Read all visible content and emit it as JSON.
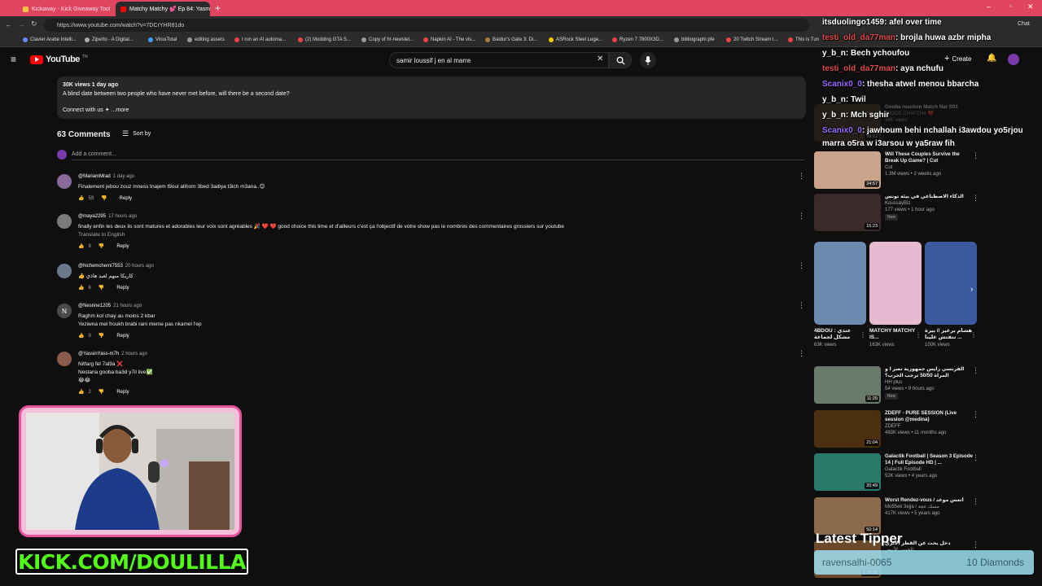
{
  "browser": {
    "tabs": [
      {
        "title": "Kickaway - Kick Giveaway Tool",
        "active": false
      },
      {
        "title": "Matchy Matchy 💕 Ep 84: Yasmin...",
        "active": true
      }
    ],
    "url": "https://www.youtube.com/watch?v=7DCrYHR81do",
    "bookmarks": [
      "Clavier Arabe Intelli...",
      "Ziperto - A Digital...",
      "VirusTotal",
      "editing assets",
      "I run an AI automa...",
      "(2) Modding GTA S...",
      "Copy of hr-newslet...",
      "Napkin AI - The vis...",
      "Baidur's Gate 3: Di...",
      "ASRock Steel Lege...",
      "Ryzen 7 7800X3D...",
      "bibliographi pfe",
      "20 Twitch Stream I...",
      "This is Tun"
    ],
    "chat_label": "Chat"
  },
  "youtube": {
    "logo": "YouTube",
    "logo_sup": "TN",
    "search_value": "samir loussif j en al marre",
    "create_label": "Create"
  },
  "description": {
    "meta": "30K views  1 day ago",
    "text": "A blind date between two people who have never met before, will there be a second date?",
    "connect": "Connect with us  ✦  ...more"
  },
  "comments_header": {
    "count": "63 Comments",
    "sort": "Sort by",
    "add_placeholder": "Add a comment..."
  },
  "comments": [
    {
      "author": "@MariamMrad",
      "time": "1 day ago",
      "lines": [
        "Finalement jebou zouz mness tnajem t9oul alihom 3bed 3adiya t3ich m3ana..😊"
      ],
      "likes": "59",
      "extra": "",
      "avatar_color": "#8a6a9a"
    },
    {
      "author": "@maya2295",
      "time": "17 hours ago",
      "lines": [
        "finally enfin les deux ils sont matures et adorables leur voix sont agréables 🎉 ❤️ ❤️ good choice this time et d'ailleurs c'est ça l'objectif de votre show pas le nombres des commentaires grossiers sur youtube"
      ],
      "likes": "8",
      "extra": "Translate to English",
      "avatar_color": "#7a7a7a"
    },
    {
      "author": "@hichemchemi7553",
      "time": "20 hours ago",
      "lines": [
        "👍 كاريكا منهم لعبد هاذي"
      ],
      "likes": "6",
      "extra": "",
      "avatar_color": "#6a7a8a"
    },
    {
      "author": "@Nesrine1205",
      "time": "21 hours ago",
      "lines": [
        "Raghm kol chay au moins 2 kbar",
        "Yeziwna mel froukh brabi rani meme pas nkamel l'ep"
      ],
      "likes": "9",
      "extra": "",
      "avatar_color": "#4a4a4a",
      "initial": "N"
    },
    {
      "author": "@YassinYass-m7h",
      "time": "2 hours ago",
      "lines": [
        "Nitfarg fel 7al9a ❌",
        "Nestana gooba ba3d y7il live✅",
        "😂😂"
      ],
      "likes": "2",
      "extra": "",
      "avatar_color": "#8a5a4a"
    }
  ],
  "reply_label": "Reply",
  "related": [
    {
      "title": "Will These Couples Survive the Break Up Game? | Cut",
      "channel": "Cut",
      "meta": "1.3M views • 2 weeks ago",
      "duration": "24:57",
      "new": false,
      "color": "#c9a38a"
    },
    {
      "title": "الذكاء الاصطناعي في بيئة تونس",
      "channel": "KoussayBiz",
      "meta": "177 views • 1 hour ago",
      "duration": "15:23",
      "new": true,
      "color": "#3a2a2a"
    },
    {
      "title": "الفرنسي رايس جمهورية تصر ا و المراة 50/50 ترجب الحرب؟",
      "channel": "HH plus",
      "meta": "54 views • 9 hours ago",
      "duration": "11:29",
      "new": true,
      "color": "#6a7a6a"
    },
    {
      "title": "ZDEFF - PURE SESSION (Live session @medina)",
      "channel": "ZDEFF",
      "meta": "493K views • 11 months ago",
      "duration": "21:04",
      "new": false,
      "color": "#4a3010"
    },
    {
      "title": "Galactik Football | Season 3 Episode 14 | Full Episode HD | ...",
      "channel": "Galactik Football",
      "meta": "52K views • 4 years ago",
      "duration": "20:49",
      "new": false,
      "color": "#2a7a6a"
    },
    {
      "title": "Worst Rendez-vous / أتعس موعد",
      "channel": "Mo55ek 3ejja / مسك عجة",
      "meta": "417K views • 5 years ago",
      "duration": "50:14",
      "new": false,
      "color": "#8a6a4a"
    },
    {
      "title": "دخل بحث عن القطر الأثري",
      "channel": "الحسن الأبيض",
      "meta": "",
      "duration": "1:20:38",
      "new": false,
      "color": "#6a4a2a"
    }
  ],
  "faded_related": [
    {
      "title": "Gooba reaction Match Nar S03",
      "channel": "ZOZOS CHAFCHA 💔",
      "meta": "34K views",
      "duration": "58:12"
    }
  ],
  "shorts": [
    {
      "title": "4BDOU : عندي مشكل لجماعة",
      "views": "63K views",
      "color": "#6a8ab0"
    },
    {
      "title": "MATCHY MATCHY IS...",
      "views": "163K views",
      "color": "#e8b8d0"
    },
    {
      "title": "هشام برغيز // بيرة تتفتش علينا ...",
      "views": "100K views",
      "color": "#3a5aa0"
    }
  ],
  "chat": [
    {
      "user": "itsduolingo1459",
      "msg": ": afel over time",
      "user_color": "#ffffff"
    },
    {
      "user": "testi_old_da77man",
      "msg": ": brojla huwa azbr mipha",
      "user_color": "#e14b4b"
    },
    {
      "user": "y_b_n",
      "msg": ": Bech ychoufou",
      "user_color": "#ffffff"
    },
    {
      "user": "testi_old_da77man",
      "msg": ": aya nchufu",
      "user_color": "#e14b4b"
    },
    {
      "user": "Scanix0_0",
      "msg": ": thesha atwel menou bbarcha",
      "user_color": "#9b6cff"
    },
    {
      "user": "y_b_n",
      "msg": ": Twil",
      "user_color": "#ffffff"
    },
    {
      "user": "y_b_n",
      "msg": ": Mch sghir",
      "user_color": "#ffffff"
    },
    {
      "user": "Scanix0_0",
      "msg": ": jawhoum behi nchallah i3awdou yo5rjou",
      "user_color": "#9b6cff"
    },
    {
      "user": "",
      "msg": "marra o5ra w i3arsou w ya5raw fih",
      "user_color": "#ffffff"
    }
  ],
  "stream": {
    "kick_text": "KICK.COM/DOULILLA",
    "tipper_label": "Latest Tipper",
    "tipper_name": "ravensalhi-0065",
    "tipper_amount": "10 Diamonds"
  },
  "colors": {
    "accent": "#ff0000",
    "kick_green": "#53fc18",
    "cam_border": "#e6539a",
    "tab_bar": "#e0455f"
  }
}
